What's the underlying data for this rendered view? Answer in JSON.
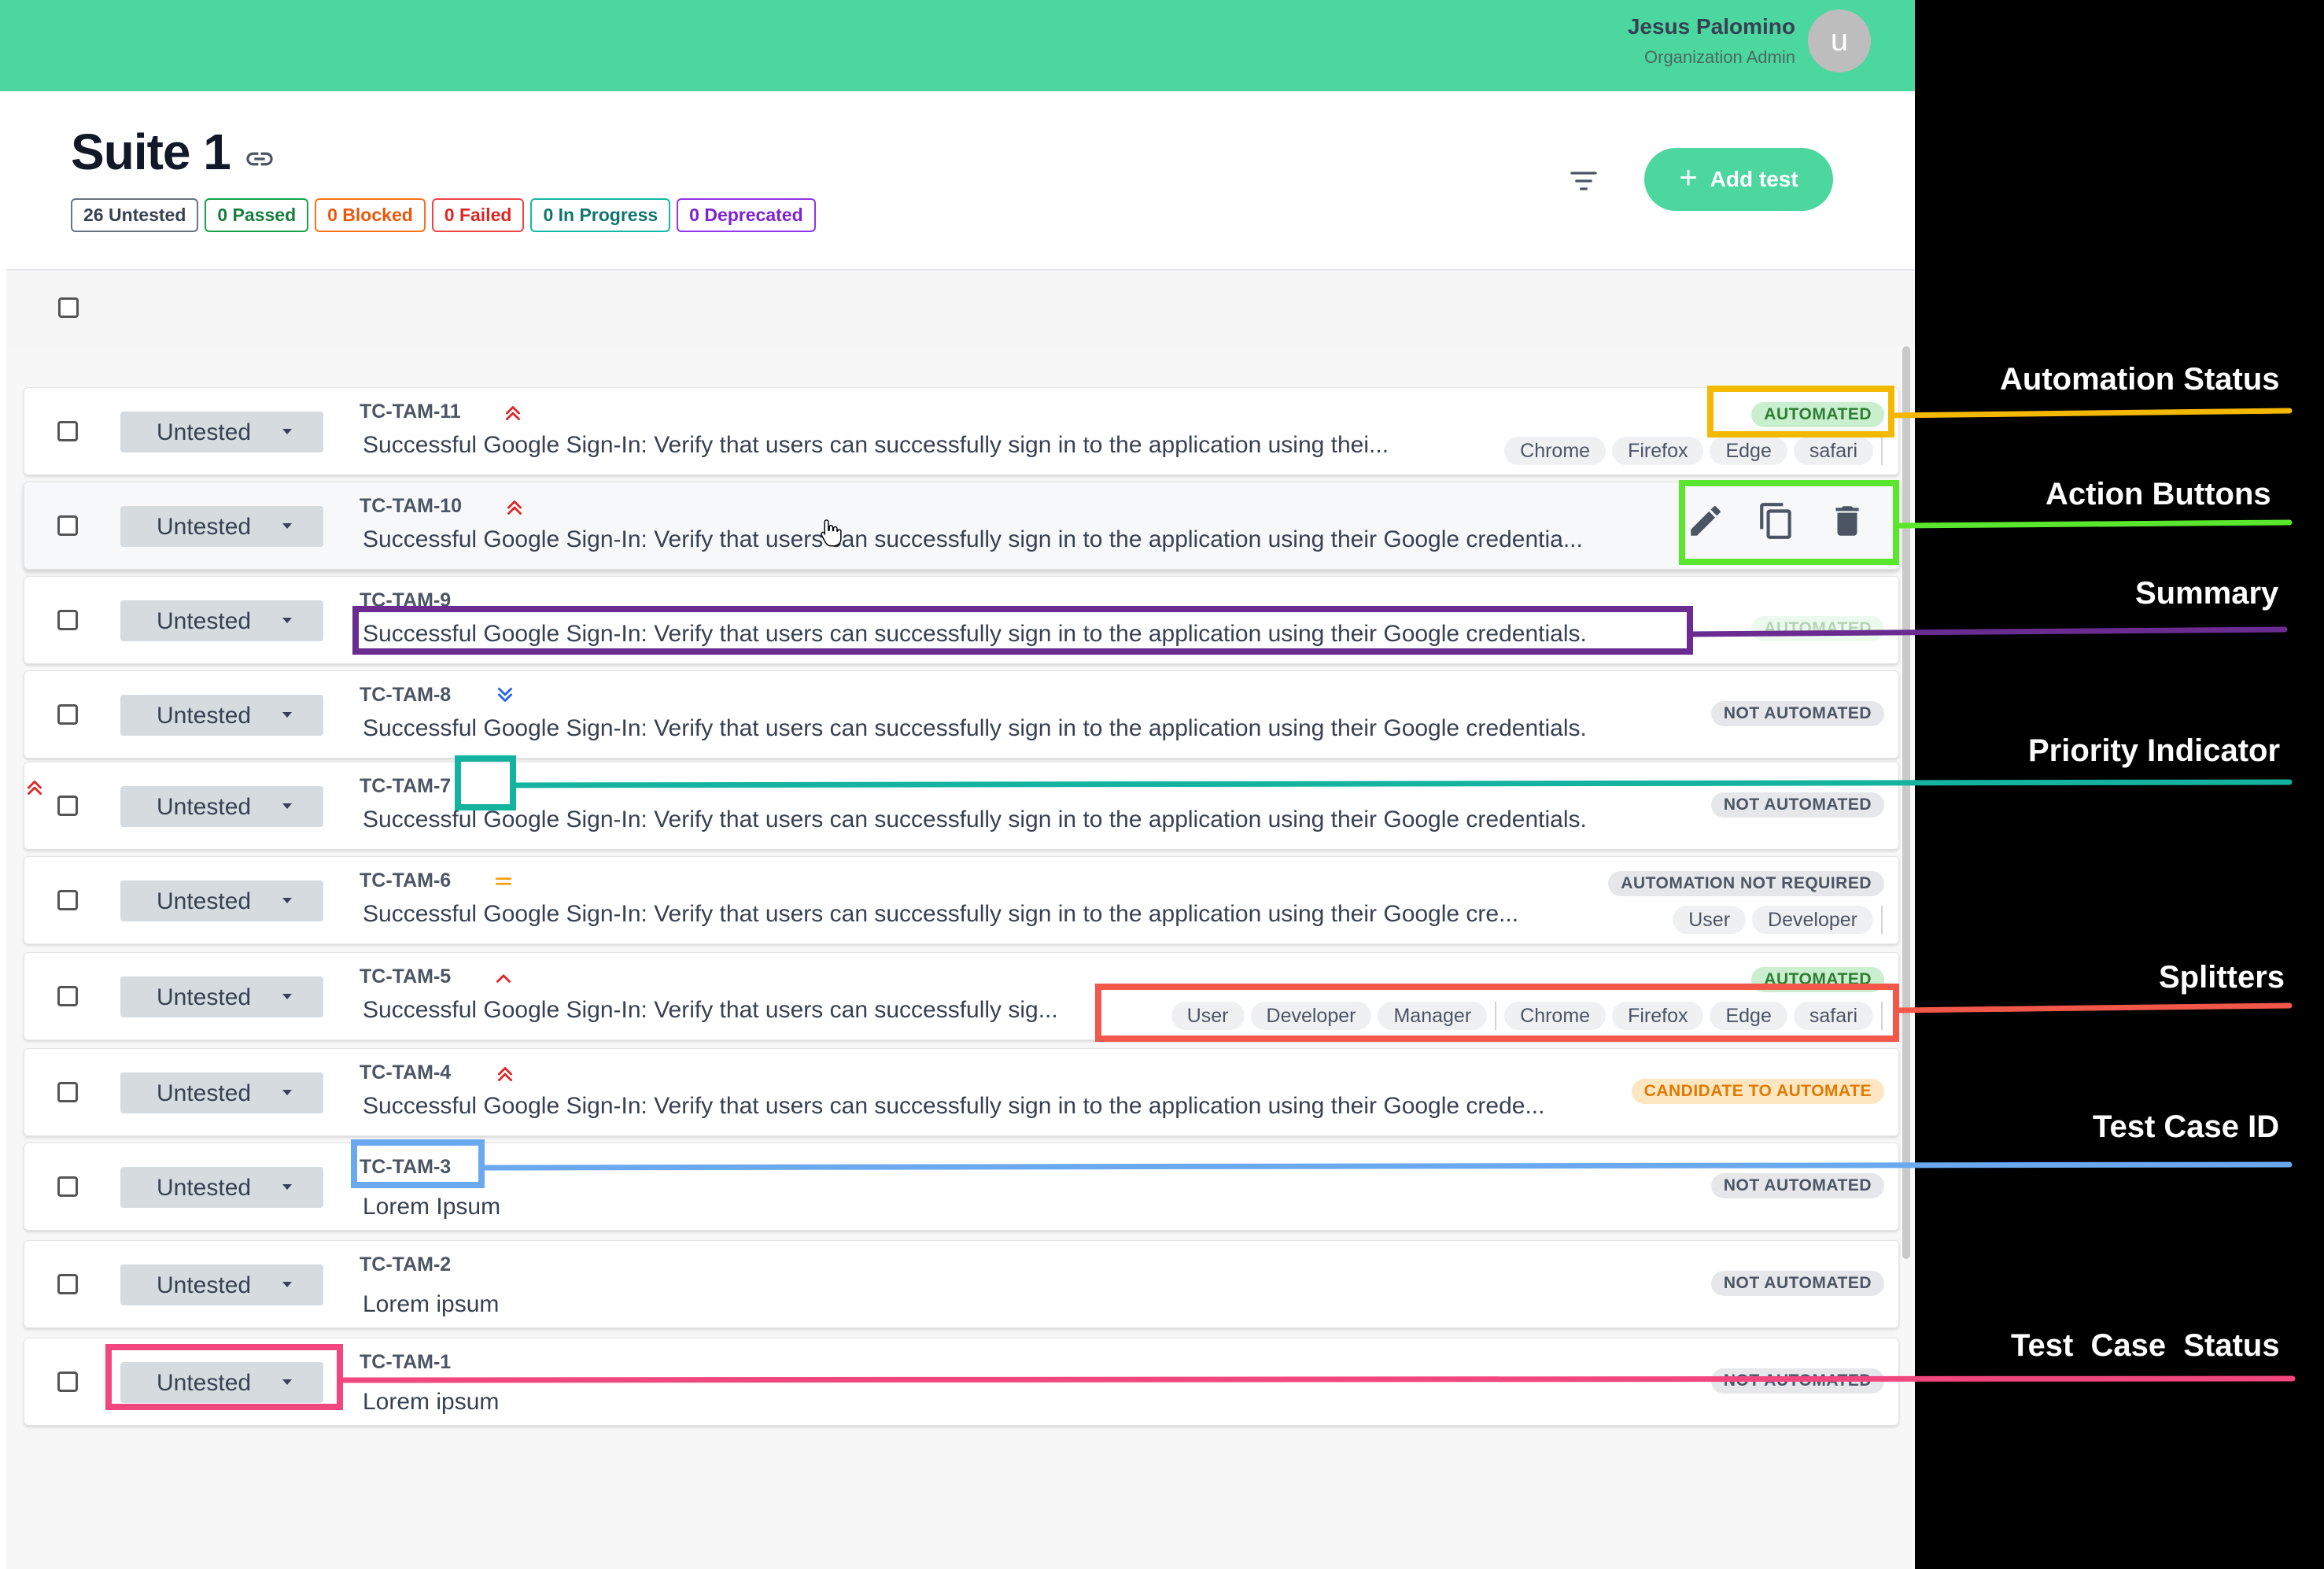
{
  "user": {
    "name": "Jesus Palomino",
    "role": "Organization Admin",
    "avatar_letter": "u"
  },
  "suite": {
    "title": "Suite 1",
    "counts": [
      {
        "label": "26 Untested",
        "color": "#374151",
        "border": "#6b7280"
      },
      {
        "label": "0 Passed",
        "color": "#15803d",
        "border": "#16a34a"
      },
      {
        "label": "0 Blocked",
        "color": "#ea580c",
        "border": "#f97316"
      },
      {
        "label": "0 Failed",
        "color": "#dc2626",
        "border": "#ef4444"
      },
      {
        "label": "0 In Progress",
        "color": "#0f766e",
        "border": "#14b8a6"
      },
      {
        "label": "0 Deprecated",
        "color": "#7e22ce",
        "border": "#9333ea"
      }
    ]
  },
  "toolbar": {
    "add_label": "Add test"
  },
  "colors": {
    "accent": "#4cd6a0",
    "automated": "#4caf50",
    "not_automated": "#4b5563",
    "candidate": "#f59e0b",
    "priority_high": "#dc2626",
    "priority_low": "#2563eb",
    "priority_medium": "#f59e0b"
  },
  "rows": [
    {
      "id": "TC-TAM-11",
      "status": "Untested",
      "priority": "high",
      "summary": "Successful Google Sign-In: Verify that users can successfully sign in to the application using thei...",
      "automation": "AUTOMATED",
      "chips": [
        "Chrome",
        "Firefox",
        "Edge",
        "safari"
      ]
    },
    {
      "id": "TC-TAM-10",
      "status": "Untested",
      "priority": "high",
      "summary": "Successful Google Sign-In: Verify that users can successfully sign in to the application using their Google credentia...",
      "automation": "",
      "chips": []
    },
    {
      "id": "TC-TAM-9",
      "status": "Untested",
      "priority": "",
      "summary": "Successful Google Sign-In: Verify that users can successfully sign in to the application using their Google credentials.",
      "automation": "AUTOMATED",
      "chips": []
    },
    {
      "id": "TC-TAM-8",
      "status": "Untested",
      "priority": "low",
      "summary": "Successful Google Sign-In: Verify that users can successfully sign in to the application using their Google credentials.",
      "automation": "NOT AUTOMATED",
      "chips": []
    },
    {
      "id": "TC-TAM-7",
      "status": "Untested",
      "priority": "high",
      "summary": "Successful Google Sign-In: Verify that users can successfully sign in to the application using their Google credentials.",
      "automation": "NOT AUTOMATED",
      "chips": []
    },
    {
      "id": "TC-TAM-6",
      "status": "Untested",
      "priority": "medium",
      "summary": "Successful Google Sign-In: Verify that users can successfully sign in to the application using their Google cre...",
      "automation": "AUTOMATION NOT REQUIRED",
      "chips": [
        "User",
        "Developer"
      ]
    },
    {
      "id": "TC-TAM-5",
      "status": "Untested",
      "priority": "medium-high",
      "summary": "Successful Google Sign-In: Verify that users can successfully sig...",
      "automation": "AUTOMATED",
      "chips": [
        "User",
        "Developer",
        "Manager",
        "Chrome",
        "Firefox",
        "Edge",
        "safari"
      ]
    },
    {
      "id": "TC-TAM-4",
      "status": "Untested",
      "priority": "high",
      "summary": "Successful Google Sign-In: Verify that users can successfully sign in to the application using their Google crede...",
      "automation": "CANDIDATE TO AUTOMATE",
      "chips": []
    },
    {
      "id": "TC-TAM-3",
      "status": "Untested",
      "priority": "",
      "summary": "Lorem Ipsum",
      "automation": "NOT AUTOMATED",
      "chips": []
    },
    {
      "id": "TC-TAM-2",
      "status": "Untested",
      "priority": "",
      "summary": "Lorem ipsum",
      "automation": "NOT AUTOMATED",
      "chips": []
    },
    {
      "id": "TC-TAM-1",
      "status": "Untested",
      "priority": "",
      "summary": "Lorem ipsum",
      "automation": "NOT AUTOMATED",
      "chips": []
    }
  ],
  "annotations": [
    {
      "title": "Automation Status",
      "color": "#f5b800"
    },
    {
      "title": "Action Buttons",
      "color": "#5ae62c"
    },
    {
      "title": "Summary",
      "color": "#6a2c91"
    },
    {
      "title": "Priority Indicator",
      "color": "#13b3a0"
    },
    {
      "title": "Splitters",
      "color": "#f2574a"
    },
    {
      "title": "Test Case ID",
      "color": "#6aa9ef"
    },
    {
      "title": "Test  Case  Status",
      "color": "#f2467e"
    }
  ]
}
